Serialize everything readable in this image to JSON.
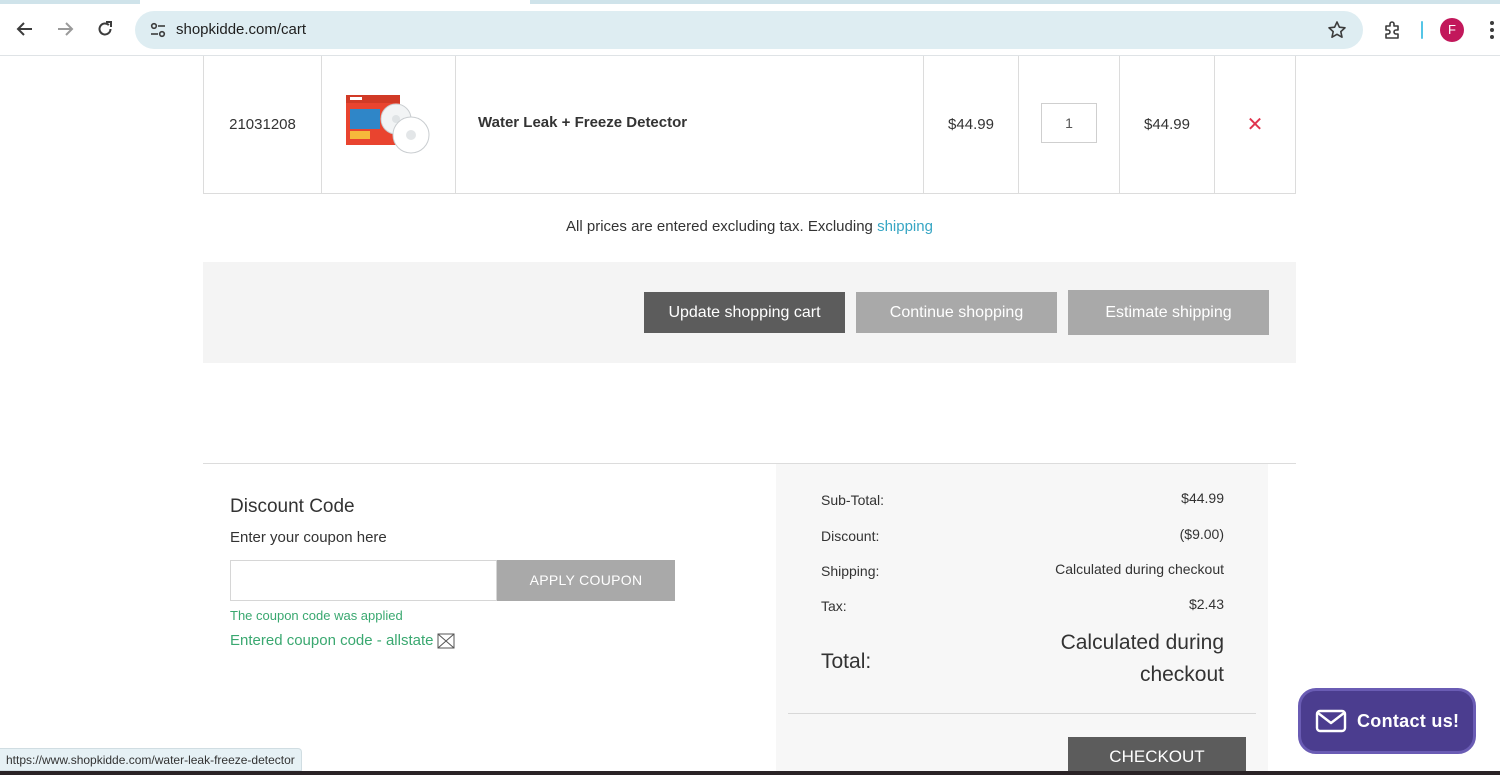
{
  "browser": {
    "url": "shopkidde.com/cart",
    "profile_initial": "F",
    "status_url": "https://www.shopkidde.com/water-leak-freeze-detector"
  },
  "cart": {
    "items": [
      {
        "sku": "21031208",
        "name": "Water Leak + Freeze Detector",
        "price": "$44.99",
        "quantity": "1",
        "total": "$44.99"
      }
    ],
    "tax_note": "All prices are entered excluding tax. Excluding",
    "shipping_link": "shipping"
  },
  "actions": {
    "update_label": "Update shopping cart",
    "continue_label": "Continue shopping",
    "estimate_label": "Estimate shipping"
  },
  "discount": {
    "title": "Discount Code",
    "subtitle": "Enter your coupon here",
    "input_value": "",
    "apply_label": "APPLY COUPON",
    "applied_message": "The coupon code was applied",
    "entered_code_text": "Entered coupon code - allstate"
  },
  "totals": {
    "subtotal_label": "Sub-Total:",
    "subtotal_value": "$44.99",
    "discount_label": "Discount:",
    "discount_value": "($9.00)",
    "shipping_label": "Shipping:",
    "shipping_value": "Calculated during checkout",
    "tax_label": "Tax:",
    "tax_value": "$2.43",
    "total_label": "Total:",
    "total_value_line1": "Calculated during",
    "total_value_line2": "checkout",
    "checkout_label": "CHECKOUT"
  },
  "contact": {
    "label": "Contact us!"
  },
  "colors": {
    "accent_link": "#37a6c4",
    "remove_red": "#e0344e",
    "success_green": "#3aa870",
    "contact_purple": "#4b3d8f",
    "dark_button": "#5c5c5c",
    "gray_button": "#a9a9a9"
  }
}
